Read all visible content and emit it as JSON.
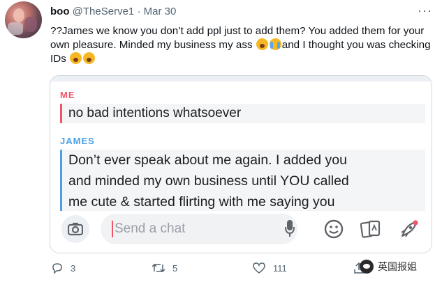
{
  "tweet": {
    "author_name": "boo",
    "author_handle": "@TheServe1",
    "separator": "·",
    "date": "Mar 30",
    "more_label": "···",
    "text_part1": "??James we know you don’t add ppl just to add them? You added them for your own pleasure. Minded my business my ass ",
    "text_part2": "and I thought you was checking IDs ",
    "emojis": [
      "yawning-face",
      "loudly-crying-face",
      "yawning-face",
      "yawning-face"
    ]
  },
  "snapchat": {
    "me_label": "ME",
    "me_message": "no bad intentions whatsoever",
    "james_label": "JAMES",
    "james_lines": [
      "Don’t ever speak about me again. I added you",
      "and minded my own business until YOU called",
      "me cute & started flirting with me saying you"
    ],
    "chat_placeholder": "Send a chat",
    "accent_me": "#ef5468",
    "accent_james": "#4a9fe8"
  },
  "actions": {
    "reply_count": "3",
    "retweet_count": "5",
    "like_count": "111"
  },
  "watermark": {
    "text": "英国报姐"
  }
}
